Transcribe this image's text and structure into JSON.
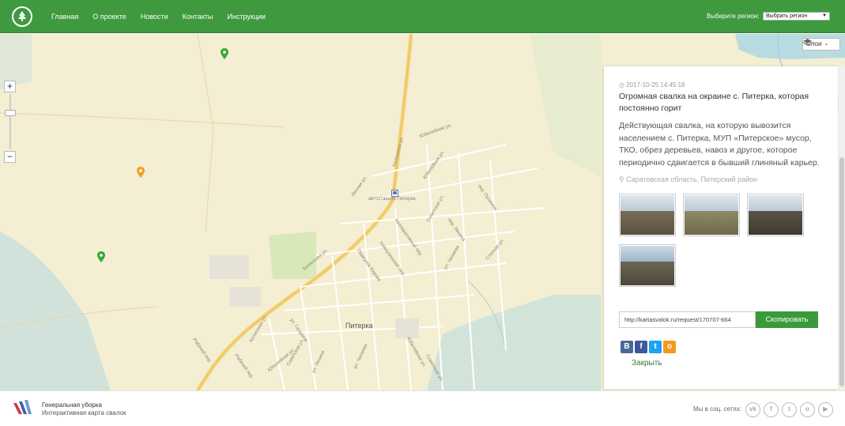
{
  "header": {
    "nav": [
      "Главная",
      "О проекте",
      "Новости",
      "Контакты",
      "Инструкции"
    ],
    "region_label": "Выберите регион:",
    "region_select": "Выбрать регион"
  },
  "map": {
    "layers_label": "Слои",
    "town": "Питерка",
    "streets": [
      "Колхозная ул.",
      "Юбилейная ул.",
      "Советская ул.",
      "Кооперативный пер.",
      "Переулок Кирова",
      "Новоузенский пер.",
      "Рабочий пер.",
      "пер. Пушкина",
      "пер. Ленина",
      "ул. Чапаева",
      "ул. Ленина",
      "ул. Гагарина",
      "Степная ул.",
      "автостанция Питерка",
      "Лесная ул."
    ]
  },
  "panel": {
    "date": "2017-10-25 14:45:18",
    "title": "Огромная свалка на окраине с. Питерка, которая постоянно горит",
    "description": "Действующая свалка, на которую вывозится населением с. Питерка, МУП «Питерское» мусор, ТКО, обрез деревьев, навоз и другое, которое периодично сдвигается в бывший глиняный карьер.",
    "location": "Саратовская область, Питерский район",
    "link": "http://kartasvalok.ru/request/170707-664",
    "copy_label": "Скопировать",
    "close_label": "Закрыть",
    "share": [
      "В",
      "f",
      "t",
      "o"
    ]
  },
  "footer": {
    "title": "Генеральная уборка",
    "subtitle": "Интерактивная карта свалок",
    "social_label": "Мы в соц. сетях:",
    "socials": [
      "vk-icon",
      "facebook-icon",
      "twitter-icon",
      "odnoklassniki-icon",
      "youtube-icon"
    ]
  },
  "colors": {
    "accent": "#3f9a3f",
    "map_bg": "#f4eed2",
    "water": "#b7dbe0",
    "road": "#f5d37a"
  }
}
